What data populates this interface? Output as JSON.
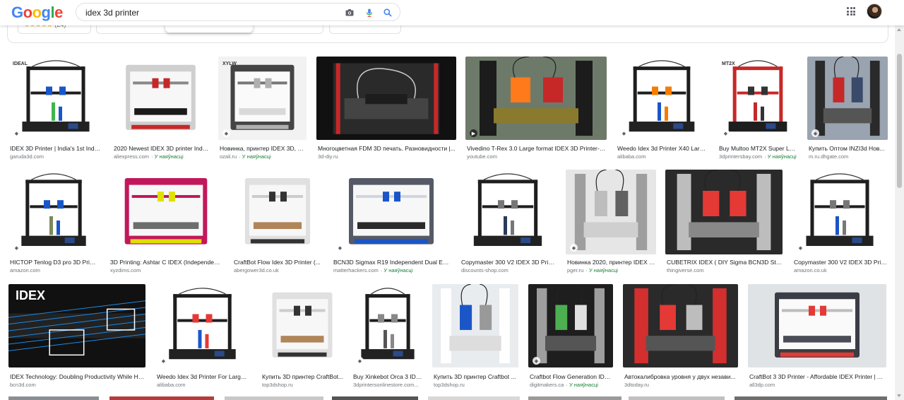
{
  "header": {
    "logo_letters": [
      {
        "ch": "G",
        "color": "#4285F4"
      },
      {
        "ch": "o",
        "color": "#EA4335"
      },
      {
        "ch": "o",
        "color": "#FBBC05"
      },
      {
        "ch": "g",
        "color": "#4285F4"
      },
      {
        "ch": "l",
        "color": "#34A853"
      },
      {
        "ch": "e",
        "color": "#EA4335"
      }
    ],
    "search_query": "idex 3d printer",
    "icons": [
      "camera-icon",
      "microphone-icon",
      "search-icon",
      "apps-grid-icon",
      "account-avatar"
    ]
  },
  "chips": {
    "rating_stars": "★★★★★",
    "rating_count": "(24)"
  },
  "results": [
    {
      "caption": "IDEX 3D Printer | India's 1st Indep...",
      "source": "garuda3d.com",
      "in_stock": "",
      "badge": "tag"
    },
    {
      "caption": "2020 Newest IDEX 3D printer Inde...",
      "source": "aliexpress.com",
      "in_stock": "· У наяўнасці",
      "badge": ""
    },
    {
      "caption": "Новинка, принтер IDEX 3D, Не...",
      "source": "ozali.ru",
      "in_stock": "· У наяўнасці",
      "badge": "tag"
    },
    {
      "caption": "Многоцветная FDM 3D печать. Разновидности |...",
      "source": "3d-diy.ru",
      "in_stock": "",
      "badge": ""
    },
    {
      "caption": "Vivedino T-Rex 3.0 Large format IDEX 3D Printer- Ti...",
      "source": "youtube.com",
      "in_stock": "",
      "badge": "play"
    },
    {
      "caption": "Weedo Idex 3d Printer X40 Larg...",
      "source": "alibaba.com",
      "in_stock": "",
      "badge": "tag"
    },
    {
      "caption": "Buy Multoo MT2X Super Lar...",
      "source": "3dprintersbay.com",
      "in_stock": "· У наяўнасці",
      "badge": "tag"
    },
    {
      "caption": "Купить Оптом INZI3d Нов...",
      "source": "m.ru.dhgate.com",
      "in_stock": "",
      "badge": "tag"
    },
    {
      "caption": "HICTOP Tenlog D3 pro 3D Print...",
      "source": "amazon.com",
      "in_stock": "",
      "badge": "tag"
    },
    {
      "caption": "3D Printing: Ashtar C IDEX (Independent ...",
      "source": "xyzdims.com",
      "in_stock": "",
      "badge": ""
    },
    {
      "caption": "CraftBot Flow Idex 3D Printer (...",
      "source": "abergower3d.co.uk",
      "in_stock": "",
      "badge": ""
    },
    {
      "caption": "BCN3D Sigmax R19 Independent Dual Extr...",
      "source": "matterhackers.com",
      "in_stock": "· У наяўнасці",
      "badge": "tag"
    },
    {
      "caption": "Copymaster 300 V2 IDEX 3D Printer",
      "source": "discounts-shop.com",
      "in_stock": "",
      "badge": ""
    },
    {
      "caption": "Новинка 2020, принтер IDEX 3...",
      "source": "pger.ru",
      "in_stock": "· У наяўнасці",
      "badge": "tag"
    },
    {
      "caption": "CUBETRIX IDEX ( DIY Sigma BCN3D Style ...",
      "source": "thingiverse.com",
      "in_stock": "",
      "badge": ""
    },
    {
      "caption": "Copymaster 300 V2 IDEX 3D Printer",
      "source": "amazon.co.uk",
      "in_stock": "",
      "badge": "tag"
    },
    {
      "caption": "IDEX Technology: Doubling Productivity While Hal...",
      "source": "bcn3d.com",
      "in_stock": "",
      "badge": ""
    },
    {
      "caption": "Weedo Idex 3d Printer For Large 3...",
      "source": "alibaba.com",
      "in_stock": "",
      "badge": "tag"
    },
    {
      "caption": "Купить 3D принтер CraftBot...",
      "source": "top3dshop.ru",
      "in_stock": "",
      "badge": ""
    },
    {
      "caption": "Buy Xinkebot Orca 3 IDE...",
      "source": "3dprintersonlinestore.com...",
      "in_stock": "",
      "badge": "tag"
    },
    {
      "caption": "Купить 3D принтер Craftbot ...",
      "source": "top3dshop.ru",
      "in_stock": "",
      "badge": ""
    },
    {
      "caption": "Craftbot Flow Generation IDE...",
      "source": "digitmakers.ca",
      "in_stock": "· У наяўнасці",
      "badge": "tag"
    },
    {
      "caption": "Автокалибровка уровня у двух незави...",
      "source": "3dtoday.ru",
      "in_stock": "",
      "badge": ""
    },
    {
      "caption": "CraftBot 3 3D Printer - Affordable IDEX Printer | All...",
      "source": "all3dp.com",
      "in_stock": "",
      "badge": ""
    }
  ],
  "thumb_styles": [
    {
      "bg": "#ffffff",
      "frame": "#1e1e1e",
      "bed": "#222222",
      "accent": "#3fb54a",
      "accent2": "#1a56c8",
      "style": "frame",
      "logo": "IDEAL"
    },
    {
      "bg": "#ffffff",
      "frame": "#cfcfcf",
      "bed": "#1a1a1a",
      "accent": "#c62828",
      "accent2": "#888888",
      "style": "box",
      "logo": ""
    },
    {
      "bg": "#f2f2f2",
      "frame": "#444444",
      "bed": "#d9d9d9",
      "accent": "#b0b0b0",
      "accent2": "#777777",
      "style": "box",
      "logo": "XYLW"
    },
    {
      "bg": "#111111",
      "frame": "#2a2a2a",
      "bed": "#444444",
      "accent": "#c62828",
      "accent2": "#cccccc",
      "style": "dark",
      "logo": ""
    },
    {
      "bg": "#6d7a6a",
      "frame": "#1c1c1c",
      "bed": "#8a7a2e",
      "accent": "#ff7a1a",
      "accent2": "#c62828",
      "style": "photo",
      "logo": ""
    },
    {
      "bg": "#ffffff",
      "frame": "#1e1e1e",
      "bed": "#222222",
      "accent": "#1a56c8",
      "accent2": "#f57c00",
      "style": "frame",
      "logo": ""
    },
    {
      "bg": "#ffffff",
      "frame": "#c62828",
      "bed": "#1e1e1e",
      "accent": "#c62828",
      "accent2": "#333333",
      "style": "frame",
      "logo": "MT2X"
    },
    {
      "bg": "#9aa3b0",
      "frame": "#2a2a2a",
      "bed": "#555555",
      "accent": "#c62828",
      "accent2": "#3a4a6a",
      "style": "photo",
      "logo": ""
    },
    {
      "bg": "#ffffff",
      "frame": "#1e1e1e",
      "bed": "#222222",
      "accent": "#7a8a5a",
      "accent2": "#1a56c8",
      "style": "frame",
      "logo": ""
    },
    {
      "bg": "#ffffff",
      "frame": "#c2185b",
      "bed": "#6d6d6d",
      "accent": "#e0e000",
      "accent2": "#c2185b",
      "style": "box",
      "logo": ""
    },
    {
      "bg": "#ffffff",
      "frame": "#e0e0e0",
      "bed": "#b0855a",
      "accent": "#333333",
      "accent2": "#cccccc",
      "style": "box",
      "logo": ""
    },
    {
      "bg": "#ffffff",
      "frame": "#555a66",
      "bed": "#2a2a2a",
      "accent": "#1a56c8",
      "accent2": "#cfd6e0",
      "style": "box",
      "logo": ""
    },
    {
      "bg": "#ffffff",
      "frame": "#1e1e1e",
      "bed": "#222222",
      "accent": "#2a3a5a",
      "accent2": "#777777",
      "style": "frame",
      "logo": ""
    },
    {
      "bg": "#e6e6e6",
      "frame": "#9e9e9e",
      "bed": "#cfcfcf",
      "accent": "#bdbdbd",
      "accent2": "#616161",
      "style": "photo",
      "logo": ""
    },
    {
      "bg": "#2a2a2a",
      "frame": "#bdbdbd",
      "bed": "#888888",
      "accent": "#e53935",
      "accent2": "#e53935",
      "style": "photo",
      "logo": ""
    },
    {
      "bg": "#ffffff",
      "frame": "#1e1e1e",
      "bed": "#222222",
      "accent": "#1a56c8",
      "accent2": "#777777",
      "style": "frame",
      "logo": ""
    },
    {
      "bg": "#111111",
      "frame": "#1e88e5",
      "bed": "#333333",
      "accent": "#ffffff",
      "accent2": "#888888",
      "style": "idex",
      "logo": "IDEX"
    },
    {
      "bg": "#ffffff",
      "frame": "#1e1e1e",
      "bed": "#222222",
      "accent": "#1a56c8",
      "accent2": "#e53935",
      "style": "frame",
      "logo": ""
    },
    {
      "bg": "#ffffff",
      "frame": "#e0e0e0",
      "bed": "#b0855a",
      "accent": "#333333",
      "accent2": "#cccccc",
      "style": "box",
      "logo": ""
    },
    {
      "bg": "#ffffff",
      "frame": "#1e1e1e",
      "bed": "#222222",
      "accent": "#555555",
      "accent2": "#888888",
      "style": "frame",
      "logo": ""
    },
    {
      "bg": "#e8ecef",
      "frame": "#ffffff",
      "bed": "#dddddd",
      "accent": "#1a56c8",
      "accent2": "#999999",
      "style": "photo",
      "logo": ""
    },
    {
      "bg": "#1e1e1e",
      "frame": "#9e9e9e",
      "bed": "#555555",
      "accent": "#4caf50",
      "accent2": "#e0e0e0",
      "style": "photo",
      "logo": ""
    },
    {
      "bg": "#2a2a2a",
      "frame": "#d32f2f",
      "bed": "#555555",
      "accent": "#e53935",
      "accent2": "#bdbdbd",
      "style": "photo",
      "logo": ""
    },
    {
      "bg": "#dfe3e6",
      "frame": "#3a3d44",
      "bed": "#4a4d55",
      "accent": "#e53935",
      "accent2": "#bdbdbd",
      "style": "box",
      "logo": ""
    }
  ]
}
